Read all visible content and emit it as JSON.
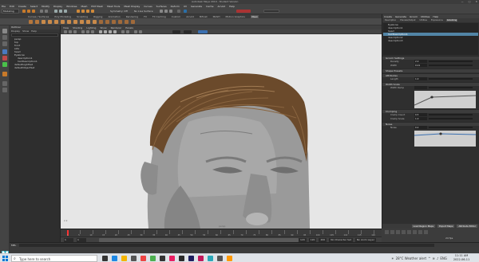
{
  "window": {
    "title": "Autodesk Maya 2019 - Student Version",
    "controls": [
      "—",
      "□",
      "✕"
    ]
  },
  "menus": [
    "File",
    "Edit",
    "Create",
    "Select",
    "Modify",
    "Display",
    "Windows",
    "Mesh",
    "Edit Mesh",
    "Mesh Tools",
    "Mesh Display",
    "Curves",
    "Surfaces",
    "Deform",
    "UV",
    "Generate",
    "Cache",
    "Arnold",
    "Help"
  ],
  "status": {
    "mode": "Modeling",
    "symmetry": "Symmetry: Off",
    "live": "No Live Surface"
  },
  "shelf_tabs": {
    "items": [
      "Curves / Surfaces",
      "Poly Modeling",
      "Sculpting",
      "Rigging",
      "Animation",
      "Rendering",
      "FX",
      "FX Caching",
      "Custom",
      "Arnold",
      "Bifrost",
      "MASH",
      "Motion Graphics",
      "XGen"
    ],
    "active_index": 13
  },
  "outliner": {
    "title": "Outliner",
    "menu": [
      "Display",
      "Show",
      "Help"
    ],
    "items": [
      {
        "label": "persp",
        "sub": false
      },
      {
        "label": "top",
        "sub": false
      },
      {
        "label": "front",
        "sub": false
      },
      {
        "label": "side",
        "sub": false
      },
      {
        "label": "head",
        "sub": false
      },
      {
        "label": "Eyebrow",
        "sub": false
      },
      {
        "label": "description1",
        "sub": true
      },
      {
        "label": "hairDescription1",
        "sub": true
      },
      {
        "label": "defaultLightSet",
        "sub": false
      },
      {
        "label": "defaultObjectSet",
        "sub": false
      }
    ]
  },
  "viewport": {
    "menu": [
      "View",
      "Shading",
      "Lighting",
      "Show",
      "Renderer",
      "Panels"
    ],
    "camera_label": "persp",
    "axis_label": "x z"
  },
  "timeline": {
    "ticks": [
      "1",
      "5",
      "10",
      "15",
      "20",
      "25",
      "30",
      "35",
      "40",
      "45",
      "50",
      "55",
      "60",
      "65",
      "70",
      "75",
      "80",
      "85",
      "90",
      "95",
      "100",
      "105",
      "110",
      "115",
      "120"
    ]
  },
  "range": {
    "start": "1",
    "start_inner": "1",
    "end_inner": "120",
    "end": "120",
    "end2": "200",
    "char": "No Character Set",
    "anim": "No Anim Layer",
    "fps": "24 fps"
  },
  "cmdline": {
    "label": "MEL"
  },
  "attr": {
    "header": [
      "Create",
      "Generate",
      "Groom",
      "Utilities",
      "Help"
    ],
    "tabs": [
      "Description",
      "Preview/Output",
      "Utilities",
      "Expressions",
      "Grooming"
    ],
    "active_tab": 4,
    "list": [
      {
        "label": "Eyebrow",
        "sel": false
      },
      {
        "label": "description1",
        "sel": false
      },
      {
        "label": "head",
        "sel": false
      },
      {
        "label": "hairDescription1",
        "sel": true
      },
      {
        "label": "description2",
        "sel": false
      },
      {
        "label": "description3",
        "sel": false
      }
    ],
    "sections": [
      {
        "title": "Groom Settings",
        "rows": [
          {
            "label": "Density",
            "val": "2.0"
          },
          {
            "label": "Width",
            "val": "0.01"
          }
        ]
      },
      {
        "title": "Shape Presets",
        "rows": []
      },
      {
        "title": "Attributes",
        "rows": [
          {
            "label": "Length",
            "val": "1.0"
          }
        ]
      },
      {
        "title": "Width Scale",
        "rows": [
          {
            "label": "Width Ramp",
            "val": ""
          }
        ]
      },
      {
        "title": "Clumping",
        "rows": [
          {
            "label": "Clump Count",
            "val": "0.5"
          },
          {
            "label": "Clump Scale",
            "val": "1.0"
          }
        ]
      },
      {
        "title": "Noise",
        "rows": [
          {
            "label": "Noise",
            "val": "0.2"
          }
        ]
      }
    ],
    "buttons": [
      "Load Region Maps",
      "Export Maps",
      "Attribute Editor"
    ]
  },
  "taskbar": {
    "search_placeholder": "Type here to search",
    "weather": "28°C  Weather alert",
    "lang": "ENG",
    "time": "11:11 AM",
    "date": "2022-06-11"
  },
  "colors": {
    "viewport_bg": "#e6e6e6",
    "selection": "#5285a6",
    "maya_teal": "#2aa7b8",
    "hair": "#6b4a2b"
  }
}
